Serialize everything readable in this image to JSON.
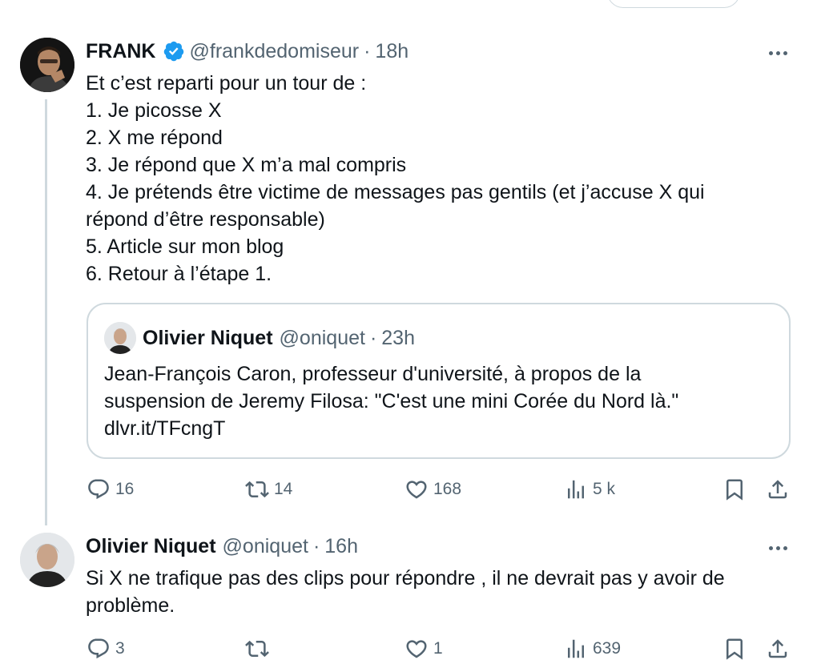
{
  "tweet1": {
    "name": "FRANK",
    "handle": "@frankdedomiseur",
    "separator": "·",
    "time": "18h",
    "lines": [
      "Et c’est reparti pour un tour de :",
      "1. Je picosse X",
      "2. X me répond",
      "3. Je répond que X m’a mal compris",
      "4. Je prétends être victime de messages pas gentils (et j’accuse X qui",
      "répond d’être responsable)",
      "5. Article sur mon blog",
      "6. Retour à l’étape 1."
    ],
    "quote": {
      "name": "Olivier Niquet",
      "handle": "@oniquet",
      "separator": "·",
      "time": "23h",
      "lines": [
        "Jean-François Caron, professeur d'université, à propos de la",
        "suspension de Jeremy Filosa: \"C'est une mini Corée du Nord là.\"",
        "dlvr.it/TFcngT"
      ]
    },
    "actions": {
      "replies": "16",
      "reposts": "14",
      "likes": "168",
      "views": "5 k"
    }
  },
  "tweet2": {
    "name": "Olivier Niquet",
    "handle": "@oniquet",
    "separator": "·",
    "time": "16h",
    "lines": [
      "Si X ne trafique pas des clips pour répondre , il ne devrait pas y avoir de",
      "problème."
    ],
    "actions": {
      "replies": "3",
      "reposts": "",
      "likes": "1",
      "views": "639"
    }
  },
  "colors": {
    "verified": "#1d9bf0",
    "secondary_text": "#536471",
    "border": "#cfd9de"
  },
  "icons": [
    "more-icon",
    "verified-badge-icon",
    "reply-icon",
    "repost-icon",
    "like-icon",
    "views-icon",
    "bookmark-icon",
    "share-icon"
  ]
}
